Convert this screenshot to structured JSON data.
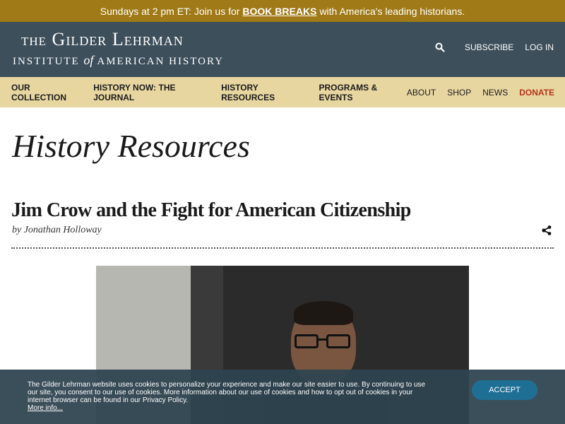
{
  "promo": {
    "prefix": "Sundays at 2 pm ET: Join us for",
    "link": "BOOK BREAKS",
    "suffix": "with America's leading historians."
  },
  "logo": {
    "the": "The",
    "name": "Gilder Lehrman",
    "institute": "INSTITUTE",
    "of": "of",
    "american_history": "AMERICAN HISTORY"
  },
  "utility_nav": {
    "search_icon": "search-icon",
    "subscribe": "SUBSCRIBE",
    "login": "LOG IN"
  },
  "main_nav": {
    "primary": [
      "OUR COLLECTION",
      "HISTORY NOW: THE JOURNAL",
      "HISTORY RESOURCES",
      "PROGRAMS & EVENTS"
    ],
    "secondary": [
      "ABOUT",
      "SHOP",
      "NEWS"
    ],
    "donate": "DONATE",
    "donate_color": "#b5341b"
  },
  "page": {
    "section_title": "History Resources",
    "article_title": "Jim Crow and the Fight for American Citizenship",
    "byline": "by Jonathan Holloway",
    "share_icon": "share-icon"
  },
  "cookie_notice": {
    "text": "The Gilder Lehrman website uses cookies to personalize your experience and make our site easier to use. By continuing to use our site, you consent to our use of cookies. More information about our use of cookies and how to opt out of cookies in your internet browser can be found in our Privacy Policy.",
    "more_link": "More info...",
    "accept": "ACCEPT"
  },
  "colors": {
    "promo_bg": "#a07a16",
    "header_bg": "#3c4f5a",
    "nav_bg": "#e8d6a1",
    "accept_bg": "#1f6f95"
  }
}
